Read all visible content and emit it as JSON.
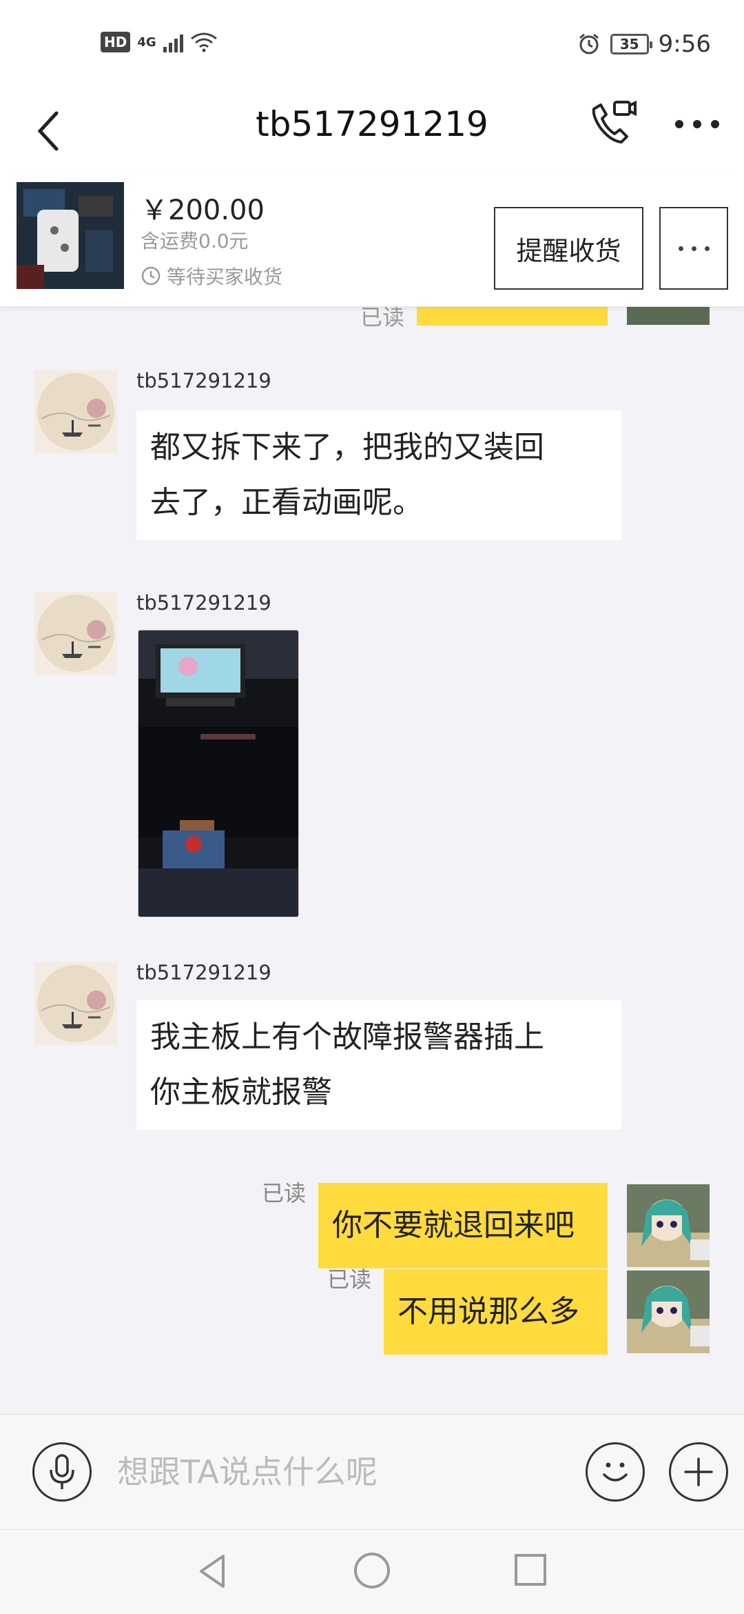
{
  "status_bar": {
    "hd": "HD",
    "network": "4G",
    "battery": "35",
    "time": "9:56"
  },
  "header": {
    "title": "tb517291219"
  },
  "order": {
    "price": "￥200.00",
    "shipping": "含运费0.0元",
    "status": "等待买家收货",
    "remind_button": "提醒收货"
  },
  "chat": {
    "partial_read": "已读",
    "messages": [
      {
        "sender": "tb517291219",
        "type": "text",
        "lines": [
          "都又拆下来了，把我的又装回",
          "去了，正看动画呢。"
        ]
      },
      {
        "sender": "tb517291219",
        "type": "image"
      },
      {
        "sender": "tb517291219",
        "type": "text",
        "lines": [
          "我主板上有个故障报警器插上",
          "你主板就报警"
        ]
      },
      {
        "sender": "me",
        "type": "text",
        "text": "你不要就退回来吧",
        "read": "已读"
      },
      {
        "sender": "me",
        "type": "text",
        "text": "不用说那么多",
        "read": "已读"
      }
    ]
  },
  "input": {
    "placeholder": "想跟TA说点什么呢"
  },
  "colors": {
    "my_bubble": "#ffdb3d",
    "background": "#f2f2f7"
  }
}
